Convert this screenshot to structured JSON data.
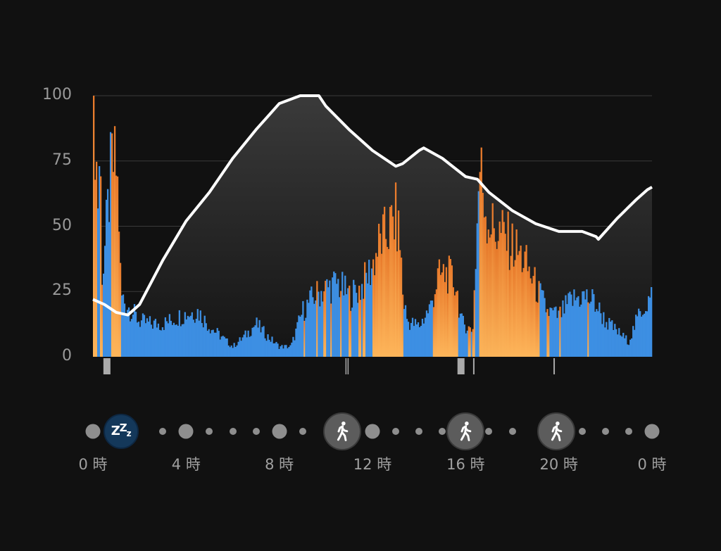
{
  "chart_data": {
    "type": "bar",
    "yticks": [
      100,
      75,
      50,
      25,
      0
    ],
    "ylim": [
      0,
      100
    ],
    "x_range_hours": [
      0,
      24
    ],
    "grid": true,
    "colors": {
      "rest": "#3d8fe3",
      "active_top": "#e8792a",
      "active_bottom": "#fdb55a",
      "line": "#ffffff",
      "background": "#111111"
    },
    "active_segments": [
      {
        "start": 0.0,
        "end": 0.2
      },
      {
        "start": 0.3,
        "end": 0.4
      },
      {
        "start": 0.8,
        "end": 1.2
      },
      {
        "start": 9.05,
        "end": 9.1
      },
      {
        "start": 9.6,
        "end": 9.65
      },
      {
        "start": 9.9,
        "end": 10.0
      },
      {
        "start": 10.2,
        "end": 10.25
      },
      {
        "start": 10.6,
        "end": 10.7
      },
      {
        "start": 11.0,
        "end": 11.1
      },
      {
        "start": 11.4,
        "end": 11.5
      },
      {
        "start": 11.6,
        "end": 11.7
      },
      {
        "start": 12.0,
        "end": 13.3
      },
      {
        "start": 14.6,
        "end": 15.7
      },
      {
        "start": 16.1,
        "end": 16.2
      },
      {
        "start": 16.3,
        "end": 16.4
      },
      {
        "start": 16.6,
        "end": 19.2
      },
      {
        "start": 19.5,
        "end": 19.6
      },
      {
        "start": 20.0,
        "end": 20.1
      },
      {
        "start": 21.2,
        "end": 21.3
      }
    ],
    "activity_profile": [
      {
        "x": 0.0,
        "y": 96
      },
      {
        "x": 0.1,
        "y": 90
      },
      {
        "x": 0.2,
        "y": 60
      },
      {
        "x": 0.3,
        "y": 84
      },
      {
        "x": 0.4,
        "y": 30
      },
      {
        "x": 0.8,
        "y": 76
      },
      {
        "x": 1.0,
        "y": 74
      },
      {
        "x": 1.1,
        "y": 60
      },
      {
        "x": 1.2,
        "y": 24
      },
      {
        "x": 1.5,
        "y": 20
      },
      {
        "x": 2.0,
        "y": 14
      },
      {
        "x": 2.5,
        "y": 13
      },
      {
        "x": 3.0,
        "y": 13
      },
      {
        "x": 3.5,
        "y": 15
      },
      {
        "x": 4.0,
        "y": 17
      },
      {
        "x": 4.5,
        "y": 18
      },
      {
        "x": 5.0,
        "y": 12
      },
      {
        "x": 5.5,
        "y": 8
      },
      {
        "x": 6.0,
        "y": 4
      },
      {
        "x": 6.5,
        "y": 8
      },
      {
        "x": 7.0,
        "y": 13
      },
      {
        "x": 7.5,
        "y": 8
      },
      {
        "x": 8.0,
        "y": 4
      },
      {
        "x": 8.5,
        "y": 4
      },
      {
        "x": 9.0,
        "y": 18
      },
      {
        "x": 9.5,
        "y": 24
      },
      {
        "x": 10.0,
        "y": 27
      },
      {
        "x": 10.5,
        "y": 29
      },
      {
        "x": 11.0,
        "y": 24
      },
      {
        "x": 11.5,
        "y": 27
      },
      {
        "x": 12.0,
        "y": 36
      },
      {
        "x": 12.3,
        "y": 45
      },
      {
        "x": 12.7,
        "y": 50
      },
      {
        "x": 13.0,
        "y": 55
      },
      {
        "x": 13.2,
        "y": 44
      },
      {
        "x": 13.3,
        "y": 24
      },
      {
        "x": 13.5,
        "y": 14
      },
      {
        "x": 14.0,
        "y": 12
      },
      {
        "x": 14.5,
        "y": 20
      },
      {
        "x": 14.8,
        "y": 31
      },
      {
        "x": 15.2,
        "y": 33
      },
      {
        "x": 15.6,
        "y": 28
      },
      {
        "x": 15.8,
        "y": 14
      },
      {
        "x": 16.3,
        "y": 10
      },
      {
        "x": 16.6,
        "y": 76
      },
      {
        "x": 16.9,
        "y": 56
      },
      {
        "x": 17.2,
        "y": 50
      },
      {
        "x": 17.6,
        "y": 48
      },
      {
        "x": 18.0,
        "y": 44
      },
      {
        "x": 18.5,
        "y": 38
      },
      {
        "x": 18.9,
        "y": 30
      },
      {
        "x": 19.2,
        "y": 24
      },
      {
        "x": 19.5,
        "y": 18
      },
      {
        "x": 20.0,
        "y": 16
      },
      {
        "x": 20.5,
        "y": 22
      },
      {
        "x": 21.0,
        "y": 24
      },
      {
        "x": 21.5,
        "y": 22
      },
      {
        "x": 22.0,
        "y": 14
      },
      {
        "x": 22.5,
        "y": 10
      },
      {
        "x": 23.0,
        "y": 6
      },
      {
        "x": 23.5,
        "y": 18
      },
      {
        "x": 24.0,
        "y": 24
      }
    ],
    "series": [
      {
        "x": [
          0,
          0.5,
          1,
          1.5,
          2,
          3,
          4,
          5,
          6,
          7,
          8,
          8.9,
          9.7,
          10,
          11,
          12,
          13,
          13.3,
          14,
          14.2,
          15,
          16,
          16.5,
          17,
          18,
          19,
          20,
          21,
          21.6,
          21.7,
          22.5,
          23.3,
          23.8,
          24
        ],
        "y": [
          22,
          20,
          17,
          16,
          20,
          37,
          52,
          63,
          76,
          87,
          97,
          100,
          100,
          96,
          87,
          79,
          73,
          74,
          79,
          80,
          76,
          69,
          68,
          63,
          56,
          51,
          48,
          48,
          46,
          45,
          53,
          60,
          64,
          65
        ]
      }
    ],
    "stand_markers": [
      {
        "x": 0.6,
        "type": "block"
      },
      {
        "x": 10.9,
        "type": "double"
      },
      {
        "x": 15.8,
        "type": "block"
      },
      {
        "x": 16.35,
        "type": "line"
      },
      {
        "x": 19.8,
        "type": "line"
      }
    ]
  },
  "xaxis": {
    "labels": [
      {
        "text": "0 時",
        "hour": 0
      },
      {
        "text": "4 時",
        "hour": 4
      },
      {
        "text": "8 時",
        "hour": 8
      },
      {
        "text": "12 時",
        "hour": 12
      },
      {
        "text": "16 時",
        "hour": 16
      },
      {
        "text": "20 時",
        "hour": 20
      },
      {
        "text": "0 時",
        "hour": 24
      }
    ]
  },
  "timeline": {
    "icons": [
      {
        "hour": 1.2,
        "icon": "sleep-icon",
        "text": "zzz"
      },
      {
        "hour": 10.7,
        "icon": "walk-icon"
      },
      {
        "hour": 16.0,
        "icon": "walk-icon"
      },
      {
        "hour": 19.9,
        "icon": "walk-icon"
      }
    ],
    "dots": [
      {
        "hour": 0,
        "size": "large"
      },
      {
        "hour": 3,
        "size": "small"
      },
      {
        "hour": 4,
        "size": "large"
      },
      {
        "hour": 5,
        "size": "small"
      },
      {
        "hour": 6,
        "size": "small"
      },
      {
        "hour": 7,
        "size": "small"
      },
      {
        "hour": 8,
        "size": "large"
      },
      {
        "hour": 9,
        "size": "small"
      },
      {
        "hour": 12,
        "size": "large"
      },
      {
        "hour": 13,
        "size": "small"
      },
      {
        "hour": 14,
        "size": "small"
      },
      {
        "hour": 15,
        "size": "small"
      },
      {
        "hour": 17,
        "size": "small"
      },
      {
        "hour": 18,
        "size": "small"
      },
      {
        "hour": 21,
        "size": "small"
      },
      {
        "hour": 22,
        "size": "small"
      },
      {
        "hour": 23,
        "size": "small"
      },
      {
        "hour": 24,
        "size": "large"
      }
    ]
  }
}
